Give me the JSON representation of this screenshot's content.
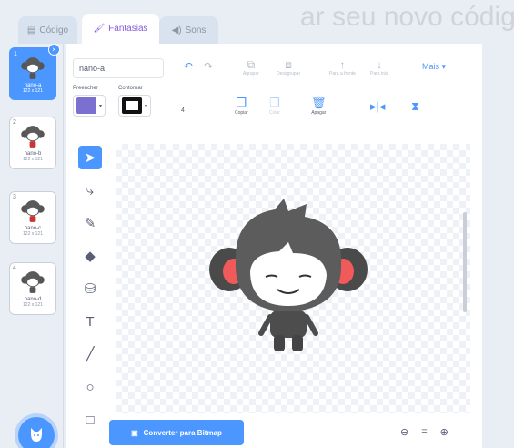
{
  "background_text": {
    "line1": "ar seu novo código",
    "line2": "",
    "line3": "",
    "line4": ""
  },
  "tabs": [
    {
      "label": "Código",
      "icon": "code-icon"
    },
    {
      "label": "Fantasias",
      "icon": "brush-icon"
    },
    {
      "label": "Sons",
      "icon": "speaker-icon"
    }
  ],
  "costumes": [
    {
      "num": "1",
      "name": "nano-a",
      "size": "122 x 121"
    },
    {
      "num": "2",
      "name": "nano-b",
      "size": "122 x 121"
    },
    {
      "num": "3",
      "name": "nano-c",
      "size": "122 x 121"
    },
    {
      "num": "4",
      "name": "nano-d",
      "size": "122 x 121"
    }
  ],
  "editor": {
    "costume_name": "nano-a",
    "undo_icon": "undo-icon",
    "redo_icon": "redo-icon",
    "group_label": "Agrupar",
    "ungroup_label": "Desagrupar",
    "forward_label": "Para a frente",
    "backward_label": "Para trás",
    "more_label": "Mais",
    "fill_label": "Preencher",
    "outline_label": "Contornar",
    "stroke_value": "4",
    "fill_color": "#7b6fd0",
    "outline_color": "#111111",
    "copy_label": "Copiar",
    "paste_label": "Colar",
    "delete_label": "Apagar",
    "convert_label": "Converter para Bitmap"
  },
  "colors": {
    "accent": "#4c97ff",
    "tab_active": "#855cd6"
  }
}
